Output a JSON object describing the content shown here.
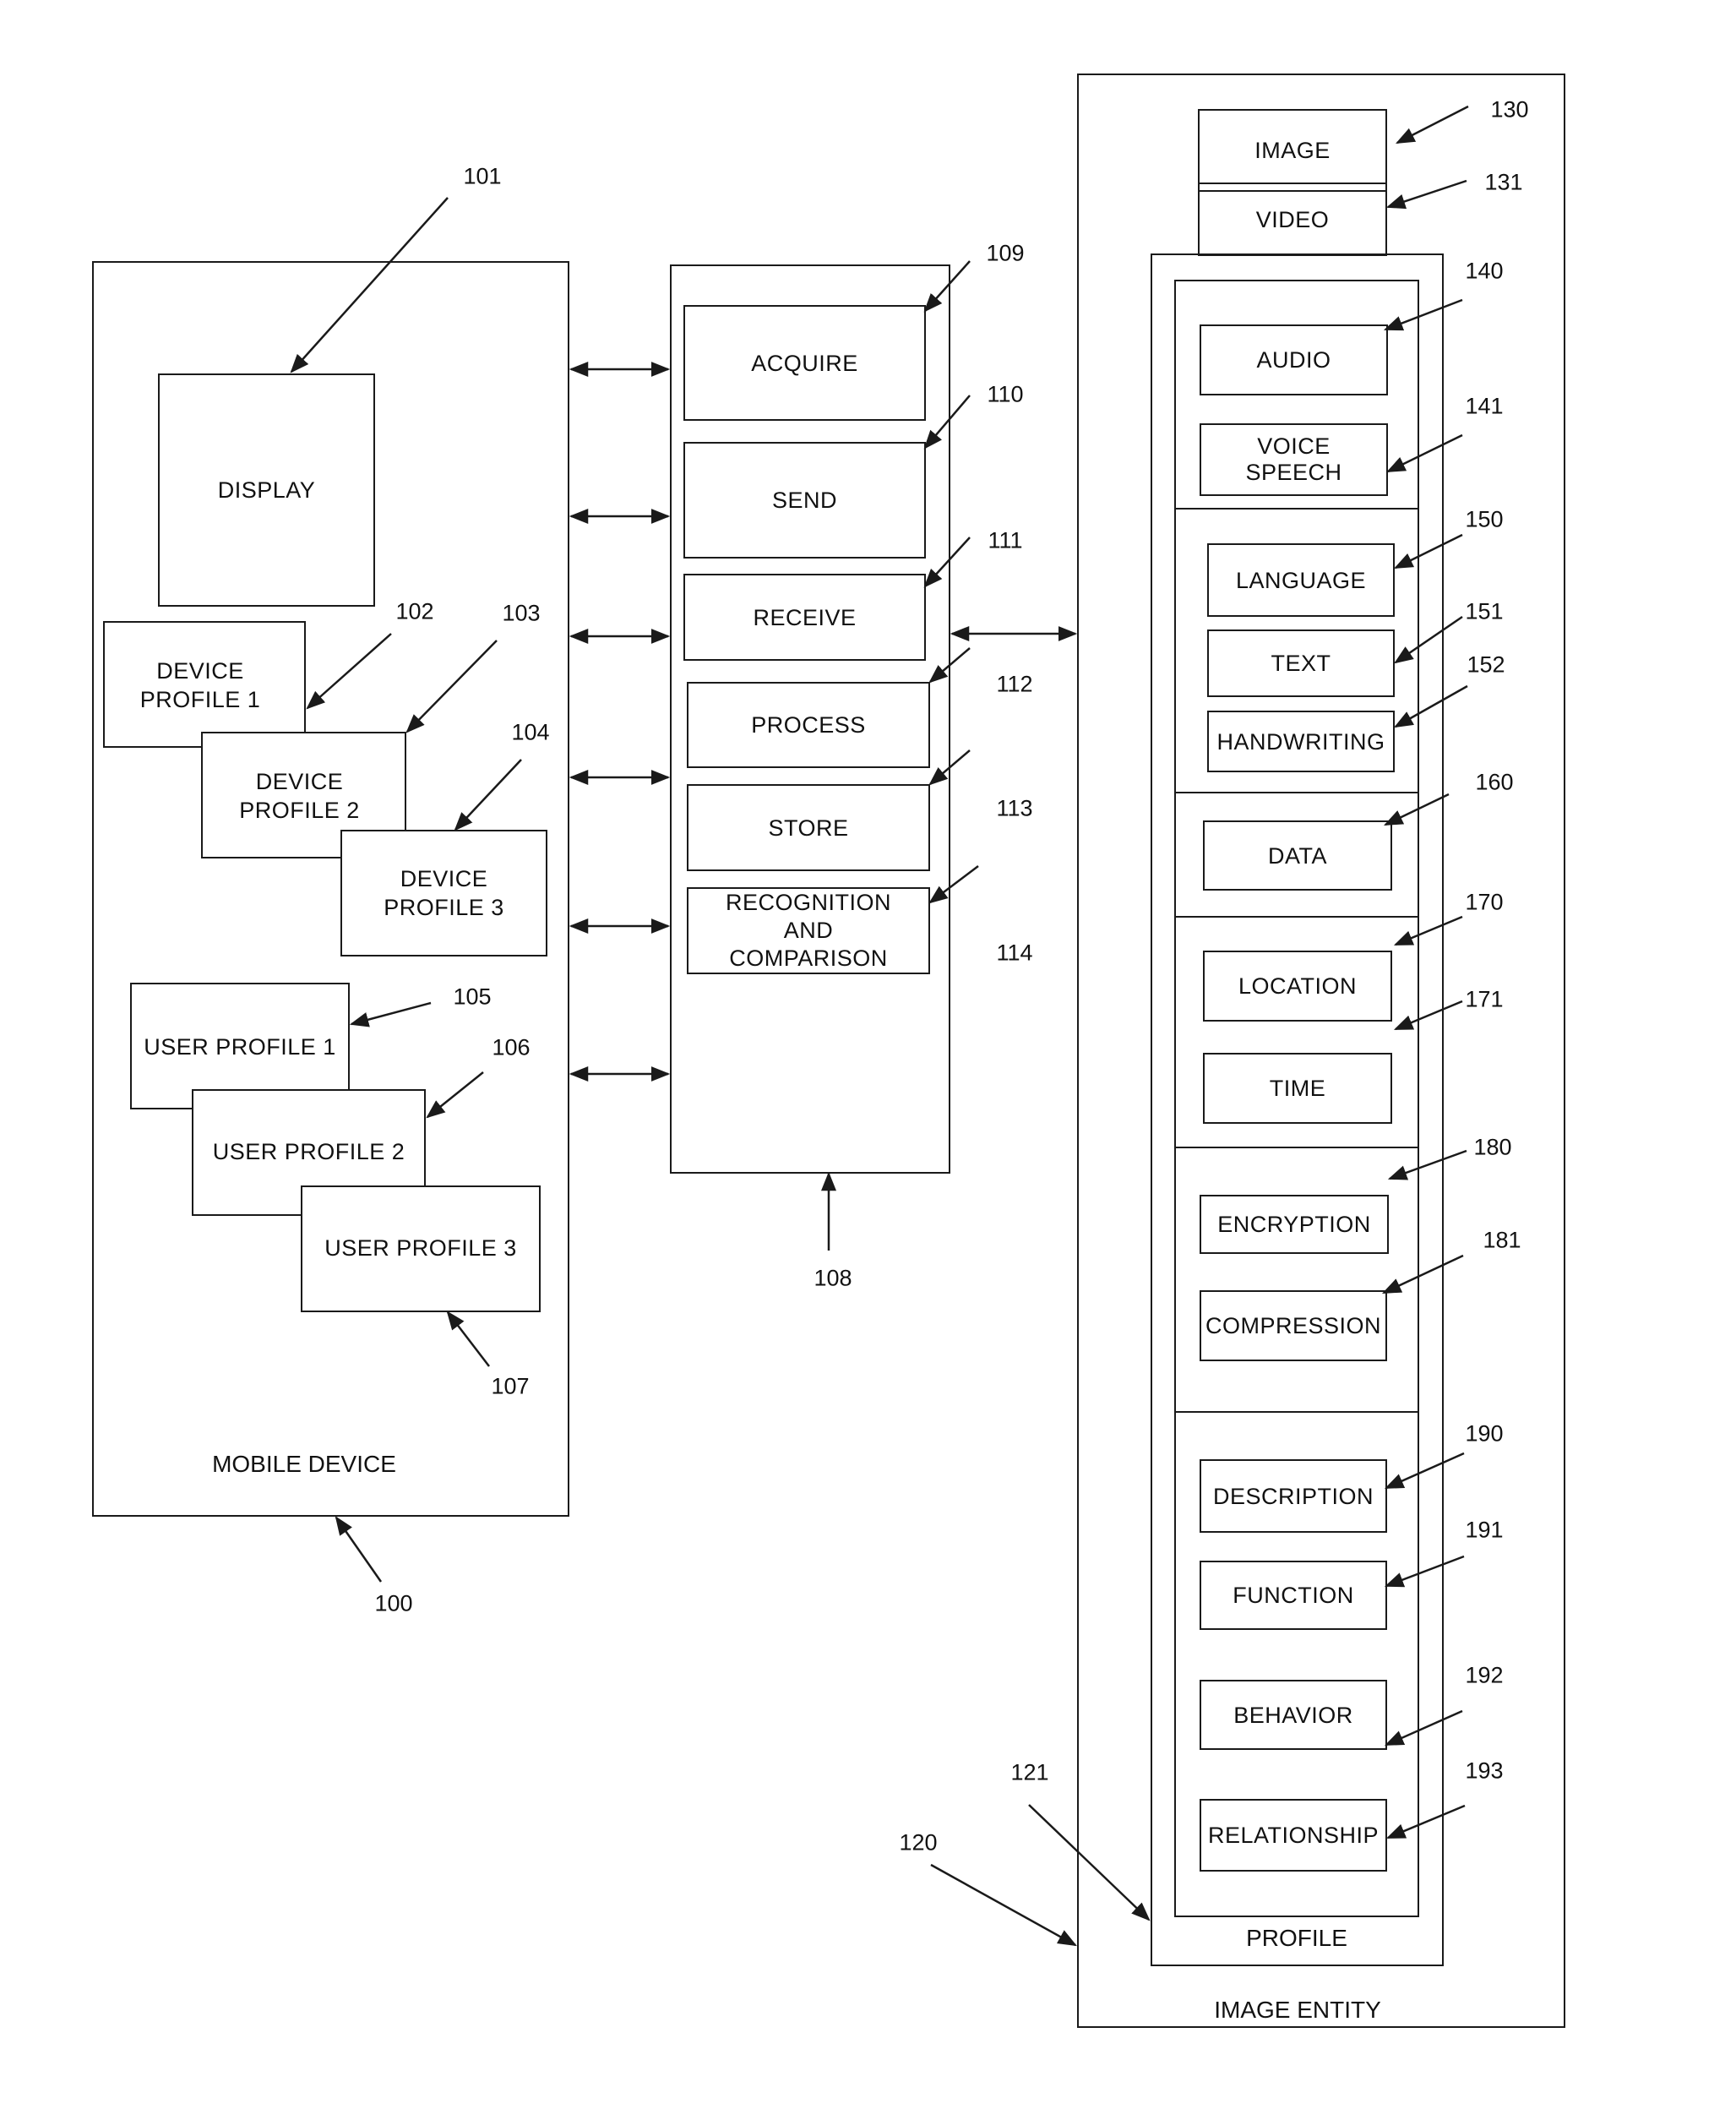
{
  "mobile_device": {
    "caption": "MOBILE DEVICE",
    "ref": "100",
    "display": {
      "label": "DISPLAY",
      "ref": "101"
    },
    "device_profiles": [
      {
        "label": "DEVICE\nPROFILE 1",
        "ref": "102"
      },
      {
        "label": "DEVICE\nPROFILE 2",
        "ref": "103"
      },
      {
        "label": "DEVICE\nPROFILE 3",
        "ref": "104"
      }
    ],
    "user_profiles": [
      {
        "label": "USER PROFILE 1",
        "ref": "105"
      },
      {
        "label": "USER PROFILE 2",
        "ref": "106"
      },
      {
        "label": "USER PROFILE 3",
        "ref": "107"
      }
    ]
  },
  "operations": {
    "ref": "108",
    "items": [
      {
        "label": "ACQUIRE",
        "ref": "109"
      },
      {
        "label": "SEND",
        "ref": "110"
      },
      {
        "label": "RECEIVE",
        "ref": "111"
      },
      {
        "label": "PROCESS",
        "ref": "112"
      },
      {
        "label": "STORE",
        "ref": "113"
      },
      {
        "label": "RECOGNITION\nAND\nCOMPARISON",
        "ref": "114"
      }
    ]
  },
  "image_entity": {
    "caption": "IMAGE ENTITY",
    "ref": "120",
    "media": [
      {
        "label": "IMAGE",
        "ref": "130"
      },
      {
        "label": "VIDEO",
        "ref": "131"
      }
    ],
    "profile": {
      "caption": "PROFILE",
      "ref": "121",
      "items": [
        {
          "label": "AUDIO",
          "ref": "140"
        },
        {
          "label": "VOICE\nSPEECH",
          "ref": "141"
        },
        {
          "label": "LANGUAGE",
          "ref": "150"
        },
        {
          "label": "TEXT",
          "ref": "151"
        },
        {
          "label": "HANDWRITING",
          "ref": "152"
        },
        {
          "label": "DATA",
          "ref": "160"
        },
        {
          "label": "LOCATION",
          "ref": "170"
        },
        {
          "label": "TIME",
          "ref": "171"
        },
        {
          "label": "ENCRYPTION",
          "ref": "180"
        },
        {
          "label": "COMPRESSION",
          "ref": "181"
        },
        {
          "label": "DESCRIPTION",
          "ref": "190"
        },
        {
          "label": "FUNCTION",
          "ref": "191"
        },
        {
          "label": "BEHAVIOR",
          "ref": "192"
        },
        {
          "label": "RELATIONSHIP",
          "ref": "193"
        }
      ]
    }
  }
}
